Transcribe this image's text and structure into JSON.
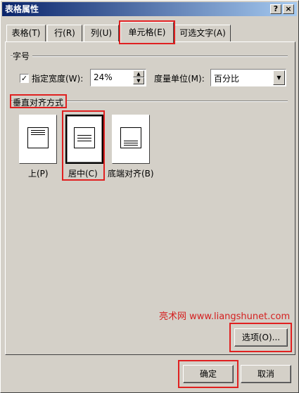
{
  "window": {
    "title": "表格属性",
    "help_glyph": "?",
    "close_glyph": "×"
  },
  "tabs": [
    {
      "label": "表格(T)"
    },
    {
      "label": "行(R)"
    },
    {
      "label": "列(U)"
    },
    {
      "label": "单元格(E)",
      "active": true
    },
    {
      "label": "可选文字(A)"
    }
  ],
  "size_group": {
    "title": "字号",
    "checkbox_label": "指定宽度(W):",
    "checkbox_checked": true,
    "width_value": "24%",
    "unit_label": "度量单位(M):",
    "unit_value": "百分比"
  },
  "valign_group": {
    "title": "垂直对齐方式",
    "options": [
      {
        "label": "上(P)",
        "icon": "align-top-icon"
      },
      {
        "label": "居中(C)",
        "icon": "align-center-icon",
        "selected": true
      },
      {
        "label": "底端对齐(B)",
        "icon": "align-bottom-icon"
      }
    ]
  },
  "watermark": "亮术网 www.liangshunet.com",
  "buttons": {
    "options": "选项(O)...",
    "ok": "确定",
    "cancel": "取消"
  },
  "colors": {
    "title_gradient_start": "#0a246a",
    "title_gradient_end": "#a6caf0",
    "highlight": "#e02020",
    "dialog_bg": "#d4d0c8"
  }
}
